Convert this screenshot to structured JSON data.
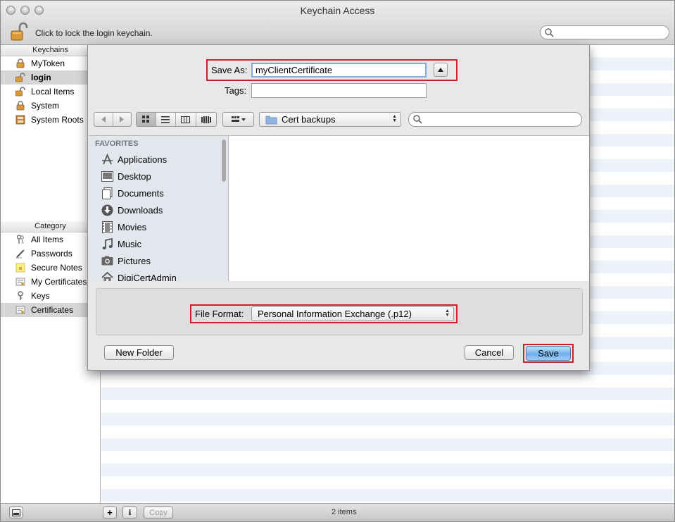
{
  "window": {
    "title": "Keychain Access",
    "lock_message": "Click to lock the login keychain.",
    "search_placeholder": ""
  },
  "sidebar": {
    "keychains_header": "Keychains",
    "keychains": [
      {
        "label": "MyToken",
        "icon": "lock-icon"
      },
      {
        "label": "login",
        "icon": "unlock-icon",
        "selected": true
      },
      {
        "label": "Local Items",
        "icon": "unlock-icon"
      },
      {
        "label": "System",
        "icon": "lock-icon"
      },
      {
        "label": "System Roots",
        "icon": "cabinet-icon"
      }
    ],
    "category_header": "Category",
    "categories": [
      {
        "label": "All Items",
        "icon": "keys-icon"
      },
      {
        "label": "Passwords",
        "icon": "pencil-icon"
      },
      {
        "label": "Secure Notes",
        "icon": "note-icon"
      },
      {
        "label": "My Certificates",
        "icon": "certificate-icon"
      },
      {
        "label": "Keys",
        "icon": "key-icon"
      },
      {
        "label": "Certificates",
        "icon": "certificate-icon",
        "selected": true
      }
    ]
  },
  "save_dialog": {
    "save_as_label": "Save As:",
    "save_as_value": "myClientCertificate",
    "tags_label": "Tags:",
    "tags_value": "",
    "location": "Cert backups",
    "search_placeholder": "",
    "favorites_header": "FAVORITES",
    "favorites": [
      {
        "label": "Applications",
        "icon": "applications-icon"
      },
      {
        "label": "Desktop",
        "icon": "desktop-icon"
      },
      {
        "label": "Documents",
        "icon": "documents-icon"
      },
      {
        "label": "Downloads",
        "icon": "downloads-icon"
      },
      {
        "label": "Movies",
        "icon": "movies-icon"
      },
      {
        "label": "Music",
        "icon": "music-icon"
      },
      {
        "label": "Pictures",
        "icon": "pictures-icon"
      },
      {
        "label": "DigiCertAdmin",
        "icon": "home-icon"
      }
    ],
    "file_format_label": "File Format:",
    "file_format_value": "Personal Information Exchange (.p12)",
    "new_folder_label": "New Folder",
    "cancel_label": "Cancel",
    "save_label": "Save"
  },
  "bottombar": {
    "add_label": "+",
    "info_label": "i",
    "copy_label": "Copy",
    "items_count": "2 items"
  },
  "colors": {
    "highlight_border": "#d01f2a",
    "primary_button": "#6fb1ee",
    "sidebar_favorites_bg": "#e3e7ed"
  }
}
